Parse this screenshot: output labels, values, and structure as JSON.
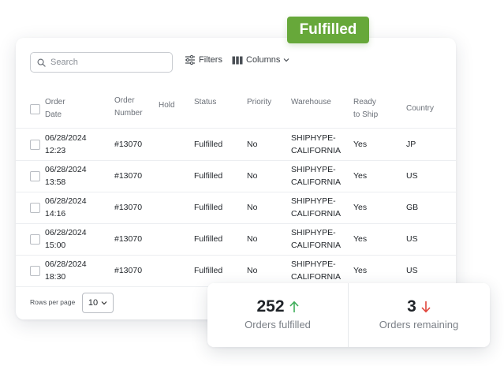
{
  "badge": {
    "label": "Fulfilled",
    "color": "#67a83a"
  },
  "toolbar": {
    "search_placeholder": "Search",
    "filters_label": "Filters",
    "columns_label": "Columns"
  },
  "table": {
    "headers": {
      "order_date": [
        "Order",
        "Date"
      ],
      "order_number": [
        "Order",
        "Number"
      ],
      "hold": "Hold",
      "status": "Status",
      "priority": "Priority",
      "warehouse": "Warehouse",
      "ready_to_ship": [
        "Ready",
        "to Ship"
      ],
      "country": "Country"
    },
    "rows": [
      {
        "date": "06/28/2024",
        "time": "12:23",
        "number": "#13070",
        "status": "Fulfilled",
        "priority": "No",
        "warehouse": [
          "SHIPHYPE-",
          "CALIFORNIA"
        ],
        "ready": "Yes",
        "country": "JP"
      },
      {
        "date": "06/28/2024",
        "time": "13:58",
        "number": "#13070",
        "status": "Fulfilled",
        "priority": "No",
        "warehouse": [
          "SHIPHYPE-",
          "CALIFORNIA"
        ],
        "ready": "Yes",
        "country": "US"
      },
      {
        "date": "06/28/2024",
        "time": "14:16",
        "number": "#13070",
        "status": "Fulfilled",
        "priority": "No",
        "warehouse": [
          "SHIPHYPE-",
          "CALIFORNIA"
        ],
        "ready": "Yes",
        "country": "GB"
      },
      {
        "date": "06/28/2024",
        "time": "15:00",
        "number": "#13070",
        "status": "Fulfilled",
        "priority": "No",
        "warehouse": [
          "SHIPHYPE-",
          "CALIFORNIA"
        ],
        "ready": "Yes",
        "country": "US"
      },
      {
        "date": "06/28/2024",
        "time": "18:30",
        "number": "#13070",
        "status": "Fulfilled",
        "priority": "No",
        "warehouse": [
          "SHIPHYPE-",
          "CALIFORNIA"
        ],
        "ready": "Yes",
        "country": "US"
      }
    ]
  },
  "footer": {
    "rows_per_page_label": "Rows per page",
    "rows_per_page_value": "10"
  },
  "stats": {
    "fulfilled": {
      "value": "252",
      "label": "Orders fulfilled",
      "arrow": "arrow-up-icon",
      "color": "#3fae5a"
    },
    "remaining": {
      "value": "3",
      "label": "Orders remaining",
      "arrow": "arrow-down-icon",
      "color": "#e0443a"
    }
  }
}
